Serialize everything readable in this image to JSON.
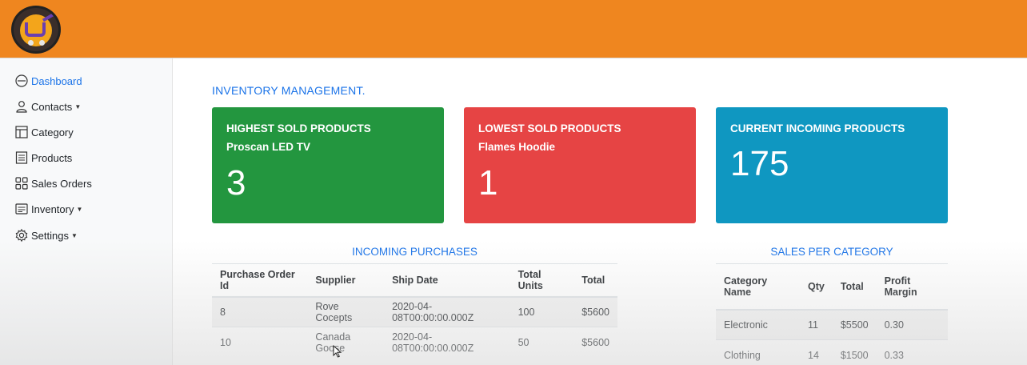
{
  "sidebar": {
    "items": [
      {
        "label": "Dashboard",
        "icon": "dashboard-circle-icon",
        "dropdown": false
      },
      {
        "label": "Contacts",
        "icon": "person-icon",
        "dropdown": true
      },
      {
        "label": "Category",
        "icon": "table-grid-icon",
        "dropdown": false
      },
      {
        "label": "Products",
        "icon": "document-list-icon",
        "dropdown": false
      },
      {
        "label": "Sales Orders",
        "icon": "four-squares-icon",
        "dropdown": false
      },
      {
        "label": "Inventory",
        "icon": "inventory-list-icon",
        "dropdown": true
      },
      {
        "label": "Settings",
        "icon": "gear-icon",
        "dropdown": true
      }
    ]
  },
  "main": {
    "heading": "INVENTORY MANAGEMENT.",
    "cards": {
      "highest": {
        "title": "HIGHEST SOLD PRODUCTS",
        "product": "Proscan LED TV",
        "value": "3"
      },
      "lowest": {
        "title": "LOWEST SOLD PRODUCTS",
        "product": "Flames Hoodie",
        "value": "1"
      },
      "incoming": {
        "title": "CURRENT INCOMING PRODUCTS",
        "value": "175"
      }
    },
    "incoming_purchases": {
      "title": "INCOMING PURCHASES",
      "columns": [
        "Purchase Order Id",
        "Supplier",
        "Ship Date",
        "Total Units",
        "Total"
      ],
      "rows": [
        [
          "8",
          "Rove Cocepts",
          "2020-04-08T00:00:00.000Z",
          "100",
          "$5600"
        ],
        [
          "10",
          "Canada Goose",
          "2020-04-08T00:00:00.000Z",
          "50",
          "$5600"
        ]
      ]
    },
    "sales_per_category": {
      "title": "SALES PER CATEGORY",
      "columns": [
        "Category Name",
        "Qty",
        "Total",
        "Profit Margin"
      ],
      "rows": [
        [
          "Electronic",
          "11",
          "$5500",
          "0.30"
        ],
        [
          "Clothing",
          "14",
          "$1500",
          "0.33"
        ]
      ]
    }
  },
  "colors": {
    "topbar": "#ef861f",
    "green_card": "#23963f",
    "red_card": "#e64444",
    "blue_card": "#0f97c1",
    "accent": "#1a73e8"
  }
}
